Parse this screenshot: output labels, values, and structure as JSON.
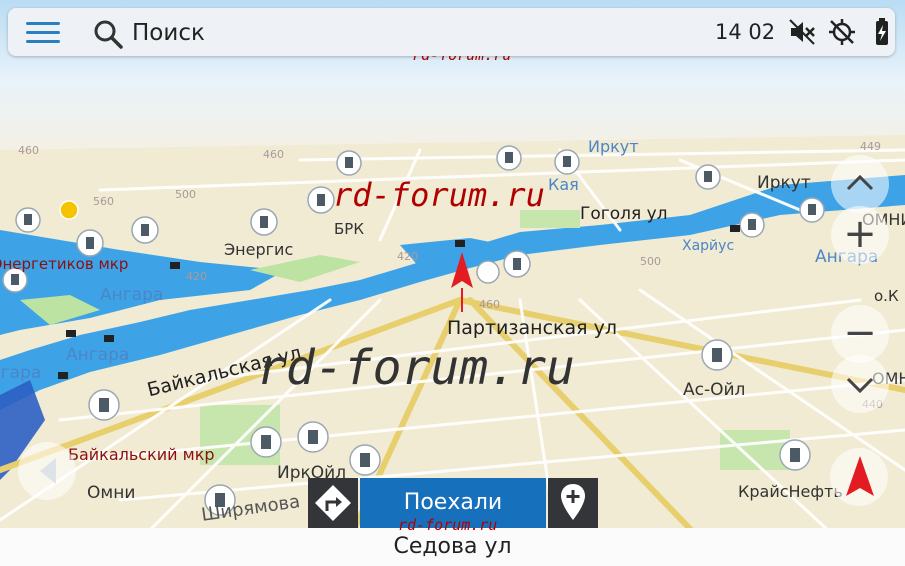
{
  "topbar": {
    "search_placeholder": "Поиск",
    "clock": "14 02",
    "status_icons": [
      "sound-off-icon",
      "location-off-icon",
      "battery-charging-icon"
    ]
  },
  "map": {
    "street_labels": [
      "Партизанская ул",
      "Байкальская ул",
      "Гоголя ул",
      "Ширямова",
      "Седова ул"
    ],
    "district_labels": [
      "Байкальский мкр",
      "Энергетиков мкр"
    ],
    "water_labels": [
      "Ангара",
      "Ангара",
      "Ангара",
      "Ангара"
    ],
    "place_labels": [
      "Иркут",
      "Иркут",
      "Кая",
      "Энергис",
      "БРК",
      "Харйус",
      "Ас-Ойл",
      "ИркОйл",
      "Омни",
      "КрайсНефть",
      "ОМНИ",
      "ОМНИ",
      "о.К"
    ],
    "altitude_labels": [
      "460",
      "460",
      "460",
      "449",
      "440",
      "420",
      "420",
      "500",
      "560",
      "500"
    ],
    "watermark_small": "rd-forum.ru",
    "watermark_big": "rd-forum.ru",
    "watermark_mid": "rd-forum.ru"
  },
  "controls": {
    "zoom_in_glyph": "+",
    "zoom_out_glyph": "−"
  },
  "route": {
    "go_label": "Поехали"
  },
  "bottom": {
    "current_street": "Седова ул"
  },
  "colors": {
    "water": "#3ea3e6",
    "primary_button": "#1770bc",
    "dark_button": "#333539",
    "compass": "#e31c24"
  }
}
